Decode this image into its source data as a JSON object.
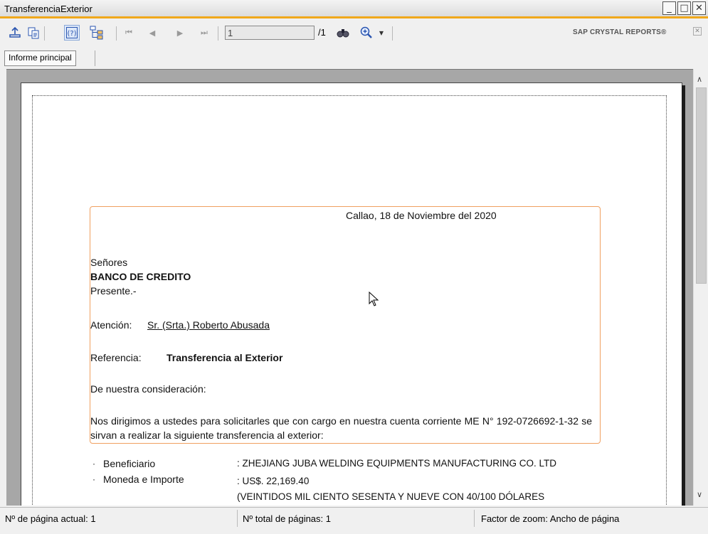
{
  "window": {
    "title": "TransferenciaExterior"
  },
  "toolbar": {
    "page_value": "1",
    "page_total": "/1",
    "brand": "SAP CRYSTAL REPORTS®",
    "icons": [
      "export-icon",
      "copy-icon",
      "help-icon",
      "group-tree-icon",
      "first-page-icon",
      "prev-page-icon",
      "next-page-icon",
      "last-page-icon",
      "find-icon",
      "zoom-icon"
    ]
  },
  "tabs": {
    "main": "Informe principal"
  },
  "report": {
    "date_line": "Callao, 18 de Noviembre del 2020",
    "salutation": "Señores",
    "bank": "BANCO DE CREDITO",
    "presente": "Presente.-",
    "attention_label": "Atención:",
    "attention_value": "Sr. (Srta.) Roberto Abusada",
    "reference_label": "Referencia:",
    "reference_value": "Transferencia al Exterior",
    "greeting": "De nuestra consideración:",
    "body": "Nos dirigimos a ustedes para solicitarles que con cargo en nuestra cuenta corriente ME N° 192-0726692-1-32 se sirvan a realizar la siguiente transferencia al exterior:",
    "fields": [
      {
        "label": "Beneficiario",
        "value": ": ZHEJIANG JUBA WELDING EQUIPMENTS MANUFACTURING CO. LTD"
      },
      {
        "label": "Moneda e Importe",
        "value": ": US$. 22,169.40"
      }
    ],
    "amount_words": "(VEINTIDOS MIL CIENTO SESENTA Y NUEVE CON  40/100 DÓLARES"
  },
  "status": {
    "current_page": "Nº de página actual: 1",
    "total_pages": "Nº total de páginas: 1",
    "zoom": "Factor de zoom: Ancho de página"
  }
}
